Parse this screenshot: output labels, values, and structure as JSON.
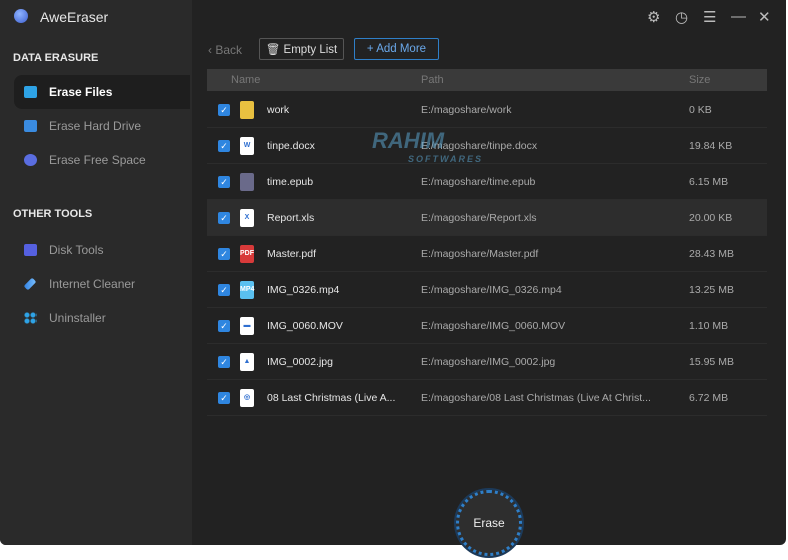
{
  "app": {
    "title": "AweEraser"
  },
  "sidebar": {
    "sections": [
      {
        "title": "DATA ERASURE",
        "items": [
          {
            "label": "Erase Files",
            "icon": "folder-icon",
            "active": true
          },
          {
            "label": "Erase Hard Drive",
            "icon": "hard-drive-icon"
          },
          {
            "label": "Erase Free Space",
            "icon": "pie-chart-icon"
          }
        ]
      },
      {
        "title": "OTHER TOOLS",
        "items": [
          {
            "label": "Disk Tools",
            "icon": "toolbox-icon"
          },
          {
            "label": "Internet Cleaner",
            "icon": "rocket-icon"
          },
          {
            "label": "Uninstaller",
            "icon": "apps-grid-icon"
          }
        ]
      }
    ]
  },
  "titlebar": {
    "icons": [
      "gear-icon",
      "clock-icon",
      "menu-icon",
      "minimize-icon",
      "close-icon"
    ],
    "glyphs": [
      "⚙",
      "◷",
      "☰",
      "—",
      "✕"
    ]
  },
  "toolbar": {
    "back": "‹  Back",
    "empty": "🗑 Empty List",
    "add": "+ Add More"
  },
  "table": {
    "headers": {
      "name": "Name",
      "path": "Path",
      "size": "Size"
    },
    "rows": [
      {
        "name": "work",
        "path": "E:/magoshare/work",
        "size": "0 KB",
        "type": "folder",
        "checked": true
      },
      {
        "name": "tinpe.docx",
        "path": "E:/magoshare/tinpe.docx",
        "size": "19.84 KB",
        "type": "word",
        "checked": true
      },
      {
        "name": "time.epub",
        "path": "E:/magoshare/time.epub",
        "size": "6.15 MB",
        "type": "epub",
        "checked": true
      },
      {
        "name": "Report.xls",
        "path": "E:/magoshare/Report.xls",
        "size": "20.00 KB",
        "type": "excel",
        "checked": true
      },
      {
        "name": "Master.pdf",
        "path": "E:/magoshare/Master.pdf",
        "size": "28.43 MB",
        "type": "pdf",
        "checked": true
      },
      {
        "name": "IMG_0326.mp4",
        "path": "E:/magoshare/IMG_0326.mp4",
        "size": "13.25 MB",
        "type": "video",
        "checked": true
      },
      {
        "name": "IMG_0060.MOV",
        "path": "E:/magoshare/IMG_0060.MOV",
        "size": "1.10 MB",
        "type": "movie",
        "checked": true
      },
      {
        "name": "IMG_0002.jpg",
        "path": "E:/magoshare/IMG_0002.jpg",
        "size": "15.95 MB",
        "type": "image",
        "checked": true
      },
      {
        "name": "08 Last Christmas  (Live A...",
        "path": "E:/magoshare/08 Last Christmas  (Live At Christ...",
        "size": "6.72 MB",
        "type": "audio",
        "checked": true
      }
    ]
  },
  "watermark": {
    "line1": "RAHIM",
    "line2": "SOFTWARES"
  },
  "erase_button": "Erase",
  "colors": {
    "accent": "#2f86e0",
    "sidebar": "#2a2a2a",
    "main": "#222222"
  }
}
